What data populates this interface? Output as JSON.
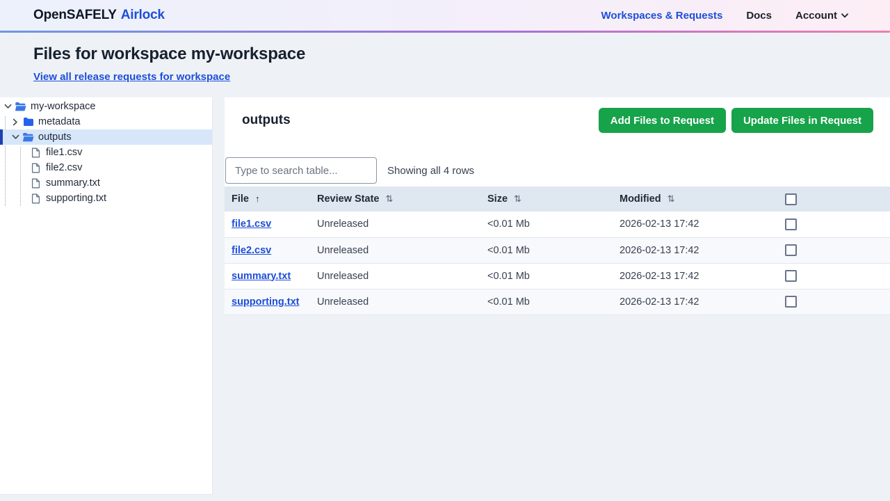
{
  "navbar": {
    "brand_primary": "OpenSAFELY",
    "brand_secondary": "Airlock",
    "links": [
      {
        "label": "Workspaces & Requests",
        "accent": true,
        "has_dropdown": false
      },
      {
        "label": "Docs",
        "accent": false,
        "has_dropdown": false
      },
      {
        "label": "Account",
        "accent": false,
        "has_dropdown": true
      }
    ]
  },
  "page_header": {
    "title": "Files for workspace my-workspace",
    "link": "View all release requests for workspace"
  },
  "file_tree": {
    "items": [
      {
        "label": "my-workspace",
        "level": 0,
        "icon": "folder-open",
        "chevron": "down",
        "selected": false
      },
      {
        "label": "metadata",
        "level": 1,
        "icon": "folder-closed",
        "chevron": "right",
        "selected": false
      },
      {
        "label": "outputs",
        "level": 1,
        "icon": "folder-open",
        "chevron": "down",
        "selected": true
      },
      {
        "label": "file1.csv",
        "level": 2,
        "icon": "file",
        "chevron": "none",
        "selected": false
      },
      {
        "label": "file2.csv",
        "level": 2,
        "icon": "file",
        "chevron": "none",
        "selected": false
      },
      {
        "label": "summary.txt",
        "level": 2,
        "icon": "file",
        "chevron": "none",
        "selected": false
      },
      {
        "label": "supporting.txt",
        "level": 2,
        "icon": "file",
        "chevron": "none",
        "selected": false
      }
    ]
  },
  "content": {
    "title": "outputs",
    "buttons": [
      {
        "label": "Add Files to Request"
      },
      {
        "label": "Update Files in Request"
      }
    ],
    "search_placeholder": "Type to search table...",
    "rows_status": "Showing all 4 rows",
    "table": {
      "columns": [
        {
          "label": "File",
          "sort": "asc"
        },
        {
          "label": "Review State",
          "sort": "both"
        },
        {
          "label": "Size",
          "sort": "both"
        },
        {
          "label": "Modified",
          "sort": "both"
        }
      ],
      "rows": [
        {
          "file": "file1.csv",
          "review_state": "Unreleased",
          "size": "<0.01 Mb",
          "modified": "2026-02-13 17:42",
          "checked": false
        },
        {
          "file": "file2.csv",
          "review_state": "Unreleased",
          "size": "<0.01 Mb",
          "modified": "2026-02-13 17:42",
          "checked": false
        },
        {
          "file": "summary.txt",
          "review_state": "Unreleased",
          "size": "<0.01 Mb",
          "modified": "2026-02-13 17:42",
          "checked": false
        },
        {
          "file": "supporting.txt",
          "review_state": "Unreleased",
          "size": "<0.01 Mb",
          "modified": "2026-02-13 17:42",
          "checked": false
        }
      ]
    }
  },
  "colors": {
    "accent_blue": "#1d4ed8",
    "button_green": "#16a34a",
    "selected_row_bg": "#d8e6fa",
    "selected_row_bar": "#1e40af",
    "table_header_bg": "#dfe7f0"
  }
}
